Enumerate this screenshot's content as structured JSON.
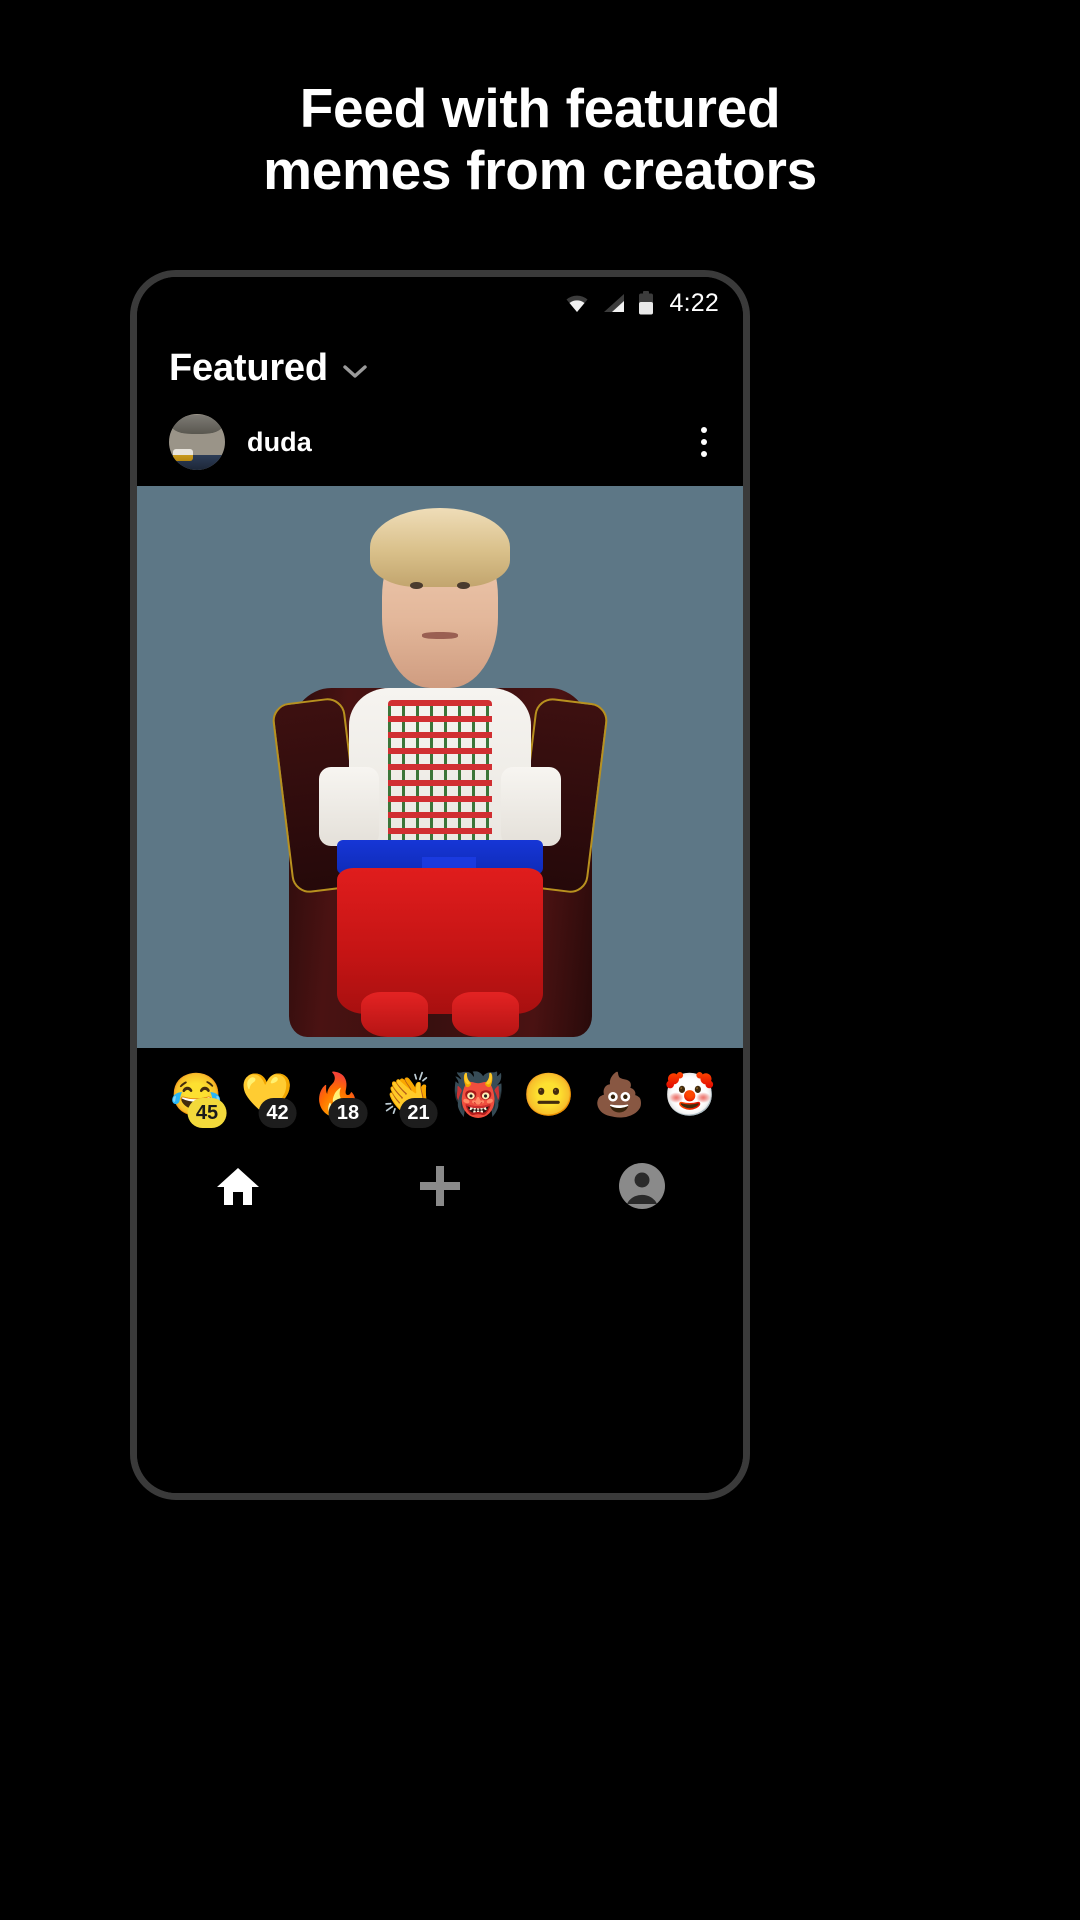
{
  "promo": {
    "headline_line1": "Feed with featured",
    "headline_line2": "memes from creators",
    "background_color": "#000000",
    "text_color": "#FFFFFF"
  },
  "phone": {
    "frame_color": "#3A3A3A",
    "screen_background": "#000000"
  },
  "status_bar": {
    "wifi_icon": "wifi-icon",
    "cellular_icon": "cellular-signal-icon",
    "battery_icon": "battery-icon",
    "time": "4:22"
  },
  "feed_header": {
    "title": "Featured",
    "dropdown_icon": "chevron-down-icon"
  },
  "post": {
    "author": "duda",
    "avatar_icon": "user-avatar",
    "overflow_icon": "kebab-menu-icon",
    "image_background_color": "#5D7786",
    "image_alt": "meme-image"
  },
  "reactions": [
    {
      "emoji": "😂",
      "name": "reaction-joy",
      "count": "45",
      "badge_style": "highlight"
    },
    {
      "emoji": "💛",
      "name": "reaction-heart",
      "count": "42",
      "badge_style": "dark"
    },
    {
      "emoji": "🔥",
      "name": "reaction-fire",
      "count": "18",
      "badge_style": "dark"
    },
    {
      "emoji": "👏",
      "name": "reaction-clap",
      "count": "21",
      "badge_style": "dark"
    },
    {
      "emoji": "👹",
      "name": "reaction-ogre",
      "count": "",
      "badge_style": "none"
    },
    {
      "emoji": "😐",
      "name": "reaction-neutral",
      "count": "",
      "badge_style": "none"
    },
    {
      "emoji": "💩",
      "name": "reaction-poop",
      "count": "",
      "badge_style": "none"
    },
    {
      "emoji": "🤡",
      "name": "reaction-clown",
      "count": "",
      "badge_style": "none"
    }
  ],
  "bottom_nav": [
    {
      "name": "nav-home",
      "icon": "home-icon",
      "active": true
    },
    {
      "name": "nav-create",
      "icon": "plus-icon",
      "active": false
    },
    {
      "name": "nav-profile",
      "icon": "profile-icon",
      "active": false
    }
  ],
  "colors": {
    "accent_badge": "#F2D93B",
    "badge_dark": "#1D1D1D",
    "inactive_nav": "#8A8A8A",
    "active_nav": "#FFFFFF"
  }
}
